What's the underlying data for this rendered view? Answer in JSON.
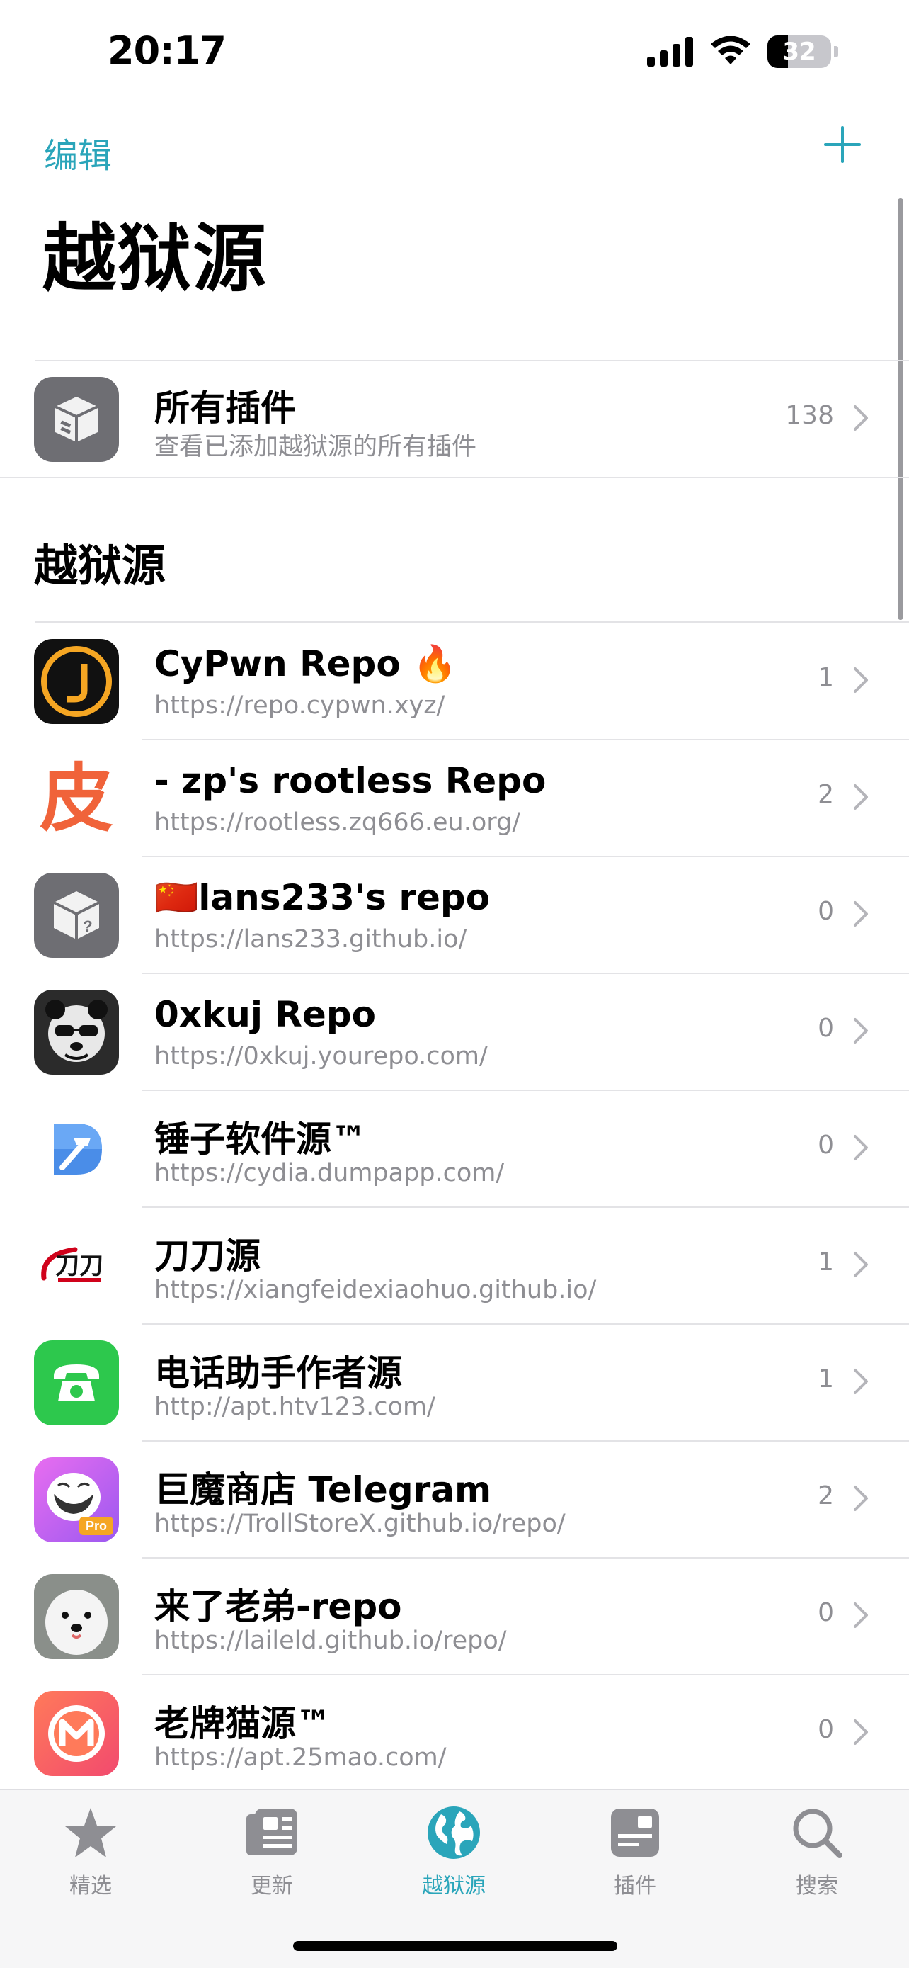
{
  "status": {
    "time": "20:17",
    "battery": "32"
  },
  "nav": {
    "edit_label": "编辑"
  },
  "page_title": "越狱源",
  "all_plugins": {
    "title": "所有插件",
    "subtitle": "查看已添加越狱源的所有插件",
    "count": "138"
  },
  "section_title": "越狱源",
  "repos": [
    {
      "title": "CyPwn Repo 🔥",
      "url": "https://repo.cypwn.xyz/",
      "count": "1"
    },
    {
      "title": "- zp's rootless Repo",
      "url": "https://rootless.zq666.eu.org/",
      "count": "2"
    },
    {
      "title": "🇨🇳lans233's repo",
      "url": "https://lans233.github.io/",
      "count": "0"
    },
    {
      "title": "0xkuj Repo",
      "url": "https://0xkuj.yourepo.com/",
      "count": "0"
    },
    {
      "title": "锤子软件源™",
      "url": "https://cydia.dumpapp.com/",
      "count": "0"
    },
    {
      "title": "刀刀源",
      "url": "https://xiangfeidexiaohuo.github.io/",
      "count": "1"
    },
    {
      "title": "电话助手作者源",
      "url": "http://apt.htv123.com/",
      "count": "1"
    },
    {
      "title": "巨魔商店 Telegram",
      "url": "https://TrollStoreX.github.io/repo/",
      "count": "2"
    },
    {
      "title": "来了老弟-repo",
      "url": "https://laileld.github.io/repo/",
      "count": "0"
    },
    {
      "title": "老牌猫源™",
      "url": "https://apt.25mao.com/",
      "count": "0"
    }
  ],
  "repo_icon_text": {
    "pi": "皮",
    "pro": "Pro",
    "daodao": "刀刀"
  },
  "tabs": [
    {
      "label": "精选",
      "icon": "star-icon"
    },
    {
      "label": "更新",
      "icon": "newspaper-icon"
    },
    {
      "label": "越狱源",
      "icon": "globe-icon"
    },
    {
      "label": "插件",
      "icon": "package-icon"
    },
    {
      "label": "搜索",
      "icon": "search-icon"
    }
  ],
  "colors": {
    "accent": "#2aa5ba",
    "secondary_text": "#8e8e93"
  }
}
